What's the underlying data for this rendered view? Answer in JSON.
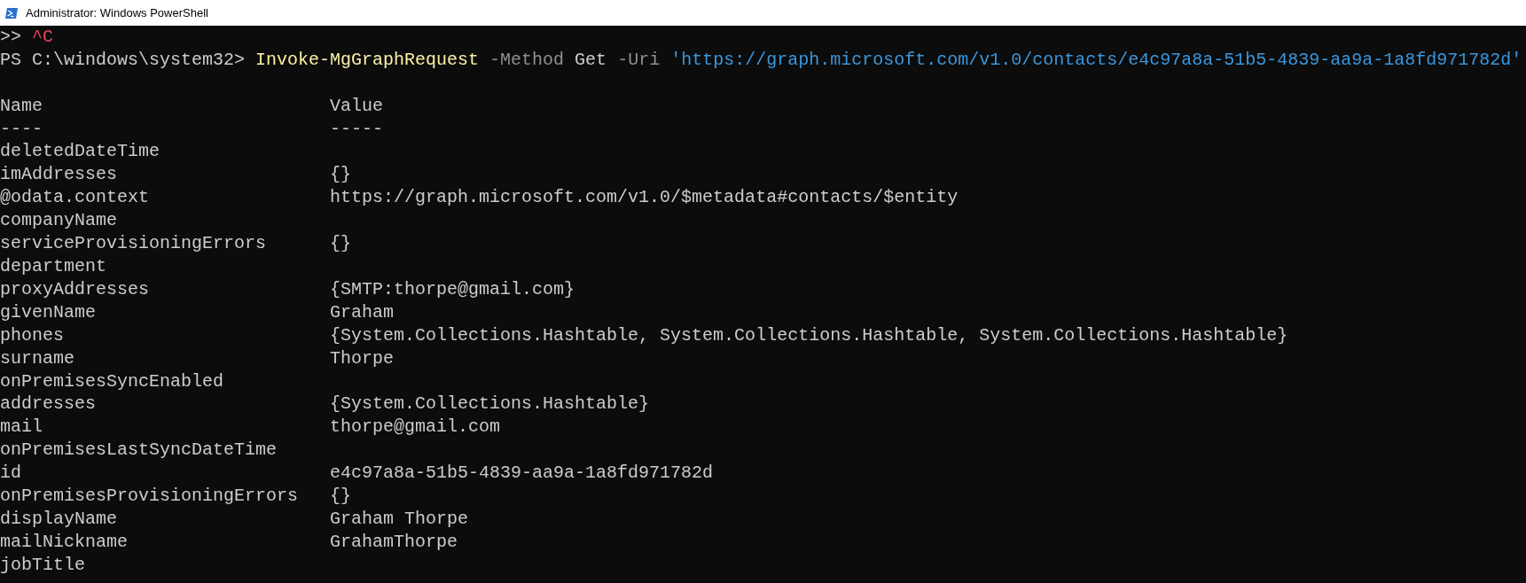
{
  "window": {
    "title": "Administrator: Windows PowerShell"
  },
  "console": {
    "interrupt_line": {
      "prompt": ">>",
      "text": "^C"
    },
    "command_line": {
      "prompt": "PS C:\\windows\\system32>",
      "tokens": [
        {
          "kind": "command",
          "text": "Invoke-MgGraphRequest"
        },
        {
          "kind": "parameter",
          "text": "-Method"
        },
        {
          "kind": "argument",
          "text": "Get"
        },
        {
          "kind": "parameter",
          "text": "-Uri"
        },
        {
          "kind": "string",
          "text": "'https://graph.microsoft.com/v1.0/contacts/e4c97a8a-51b5-4839-aa9a-1a8fd971782d'"
        }
      ]
    },
    "table": {
      "columns": [
        "Name",
        "Value"
      ],
      "separators": [
        "----",
        "-----"
      ],
      "rows": [
        {
          "name": "deletedDateTime"
        },
        {
          "name": "imAddresses",
          "value": "{}"
        },
        {
          "name": "@odata.context",
          "value": "https://graph.microsoft.com/v1.0/$metadata#contacts/$entity"
        },
        {
          "name": "companyName"
        },
        {
          "name": "serviceProvisioningErrors",
          "value": "{}"
        },
        {
          "name": "department"
        },
        {
          "name": "proxyAddresses",
          "value": "{SMTP:thorpe@gmail.com}"
        },
        {
          "name": "givenName",
          "value": "Graham"
        },
        {
          "name": "phones",
          "value": "{System.Collections.Hashtable, System.Collections.Hashtable, System.Collections.Hashtable}"
        },
        {
          "name": "surname",
          "value": "Thorpe"
        },
        {
          "name": "onPremisesSyncEnabled"
        },
        {
          "name": "addresses",
          "value": "{System.Collections.Hashtable}"
        },
        {
          "name": "mail",
          "value": "thorpe@gmail.com"
        },
        {
          "name": "onPremisesLastSyncDateTime"
        },
        {
          "name": "id",
          "value": "e4c97a8a-51b5-4839-aa9a-1a8fd971782d"
        },
        {
          "name": "onPremisesProvisioningErrors",
          "value": "{}"
        },
        {
          "name": "displayName",
          "value": "Graham Thorpe"
        },
        {
          "name": "mailNickname",
          "value": "GrahamThorpe"
        },
        {
          "name": "jobTitle"
        }
      ]
    }
  }
}
